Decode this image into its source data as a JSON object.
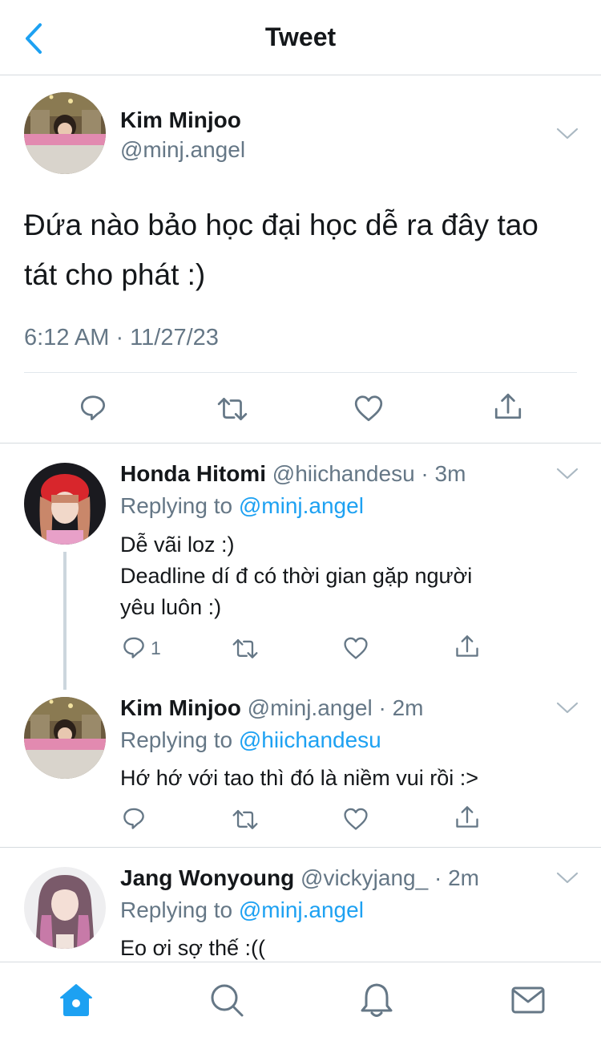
{
  "header": {
    "title": "Tweet"
  },
  "main_tweet": {
    "name": "Kim Minjoo",
    "handle": "@minj.angel",
    "text_line1": "Đứa nào bảo học đại học dễ ra đây tao",
    "text_line2": "tát cho phát :)",
    "timestamp": "6:12 AM · 11/27/23"
  },
  "replies": [
    {
      "name": "Honda Hitomi",
      "meta": "@hiichandesu · 3m",
      "replying_prefix": "Replying to ",
      "replying_to": "@minj.angel",
      "lines": [
        "Dễ vãi loz :)",
        "Deadline dí đ có thời gian gặp người",
        "yêu luôn :)"
      ],
      "reply_count": "1"
    },
    {
      "name": "Kim Minjoo",
      "meta": "@minj.angel · 2m",
      "replying_prefix": "Replying to ",
      "replying_to": "@hiichandesu",
      "lines": [
        "Hớ hớ với tao thì đó là niềm vui rồi :>"
      ]
    },
    {
      "name": "Jang Wonyoung",
      "meta": "@vickyjang_ · 2m",
      "replying_prefix": "Replying to ",
      "replying_to": "@minj.angel",
      "lines": [
        "Eo ơi sợ thế :(("
      ]
    }
  ],
  "icons": {
    "back": "chevron-left-icon",
    "more": "chevron-down-icon",
    "reply": "reply-icon",
    "retweet": "retweet-icon",
    "like": "heart-icon",
    "share": "share-icon",
    "home": "home-icon",
    "search": "search-icon",
    "notifications": "bell-icon",
    "messages": "mail-icon"
  },
  "colors": {
    "accent": "#1da1f2",
    "secondary_text": "#657786",
    "primary_text": "#14171a"
  }
}
